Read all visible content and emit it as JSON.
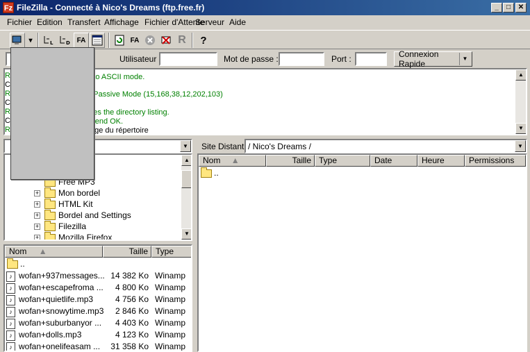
{
  "window": {
    "title": "FileZilla - Connecté à Nico's Dreams (ftp.free.fr)",
    "app_icon": "Fz"
  },
  "menu": [
    "Fichier",
    "Edition",
    "Transfert",
    "Affichage",
    "Fichier d'Attente",
    "Serveur",
    "Aide"
  ],
  "quickconnect": {
    "user_label": "Utilisateur :",
    "password_label": "Mot de passe :",
    "port_label": "Port :",
    "button_label": "Connexion Rapide",
    "user_value": "",
    "password_value": "",
    "port_value": ""
  },
  "log": {
    "lines": [
      {
        "letter": "R",
        "text": "ng to ASCII mode.",
        "color": "#008000"
      },
      {
        "letter": "C",
        "text": "",
        "color": "#000000"
      },
      {
        "letter": "R",
        "text": "ng Passive Mode (15,168,38,12,202,103)",
        "color": "#008000"
      },
      {
        "letter": "C",
        "text": "",
        "color": "#000000"
      },
      {
        "letter": "R",
        "text": "omes the directory listing.",
        "color": "#008000"
      },
      {
        "letter": "C",
        "text": "ry send OK.",
        "color": "#008000"
      },
      {
        "letter": "R",
        "text": "istage du répertoire",
        "color": "#000000"
      }
    ]
  },
  "local_tree": {
    "items": [
      {
        "name": "Free MP3"
      },
      {
        "name": "Mon bordel"
      },
      {
        "name": "HTML Kit"
      },
      {
        "name": "Bordel and Settings"
      },
      {
        "name": "Filezilla"
      },
      {
        "name": "Mozilla Firefox"
      }
    ]
  },
  "local_files": {
    "headers": {
      "name": "Nom",
      "size": "Taille",
      "type": "Type"
    },
    "parent": "..",
    "rows": [
      {
        "name": "wofan+937messages...",
        "size": "14 382 Ko",
        "type": "Winamp"
      },
      {
        "name": "wofan+escapefroma ...",
        "size": "4 800 Ko",
        "type": "Winamp"
      },
      {
        "name": "wofan+quietlife.mp3",
        "size": "4 756 Ko",
        "type": "Winamp"
      },
      {
        "name": "wofan+snowytime.mp3",
        "size": "2 846 Ko",
        "type": "Winamp"
      },
      {
        "name": "wofan+suburbanyor ...",
        "size": "4 403 Ko",
        "type": "Winamp"
      },
      {
        "name": "wofan+dolls.mp3",
        "size": "4 123 Ko",
        "type": "Winamp"
      },
      {
        "name": "wofan+onelifeasam ...",
        "size": "31 358 Ko",
        "type": "Winamp"
      }
    ]
  },
  "remote": {
    "site_label": "Site Distant :",
    "path": "/ Nico's Dreams /",
    "headers": {
      "name": "Nom",
      "size": "Taille",
      "type": "Type",
      "date": "Date",
      "time": "Heure",
      "perms": "Permissions"
    },
    "parent": ".."
  }
}
